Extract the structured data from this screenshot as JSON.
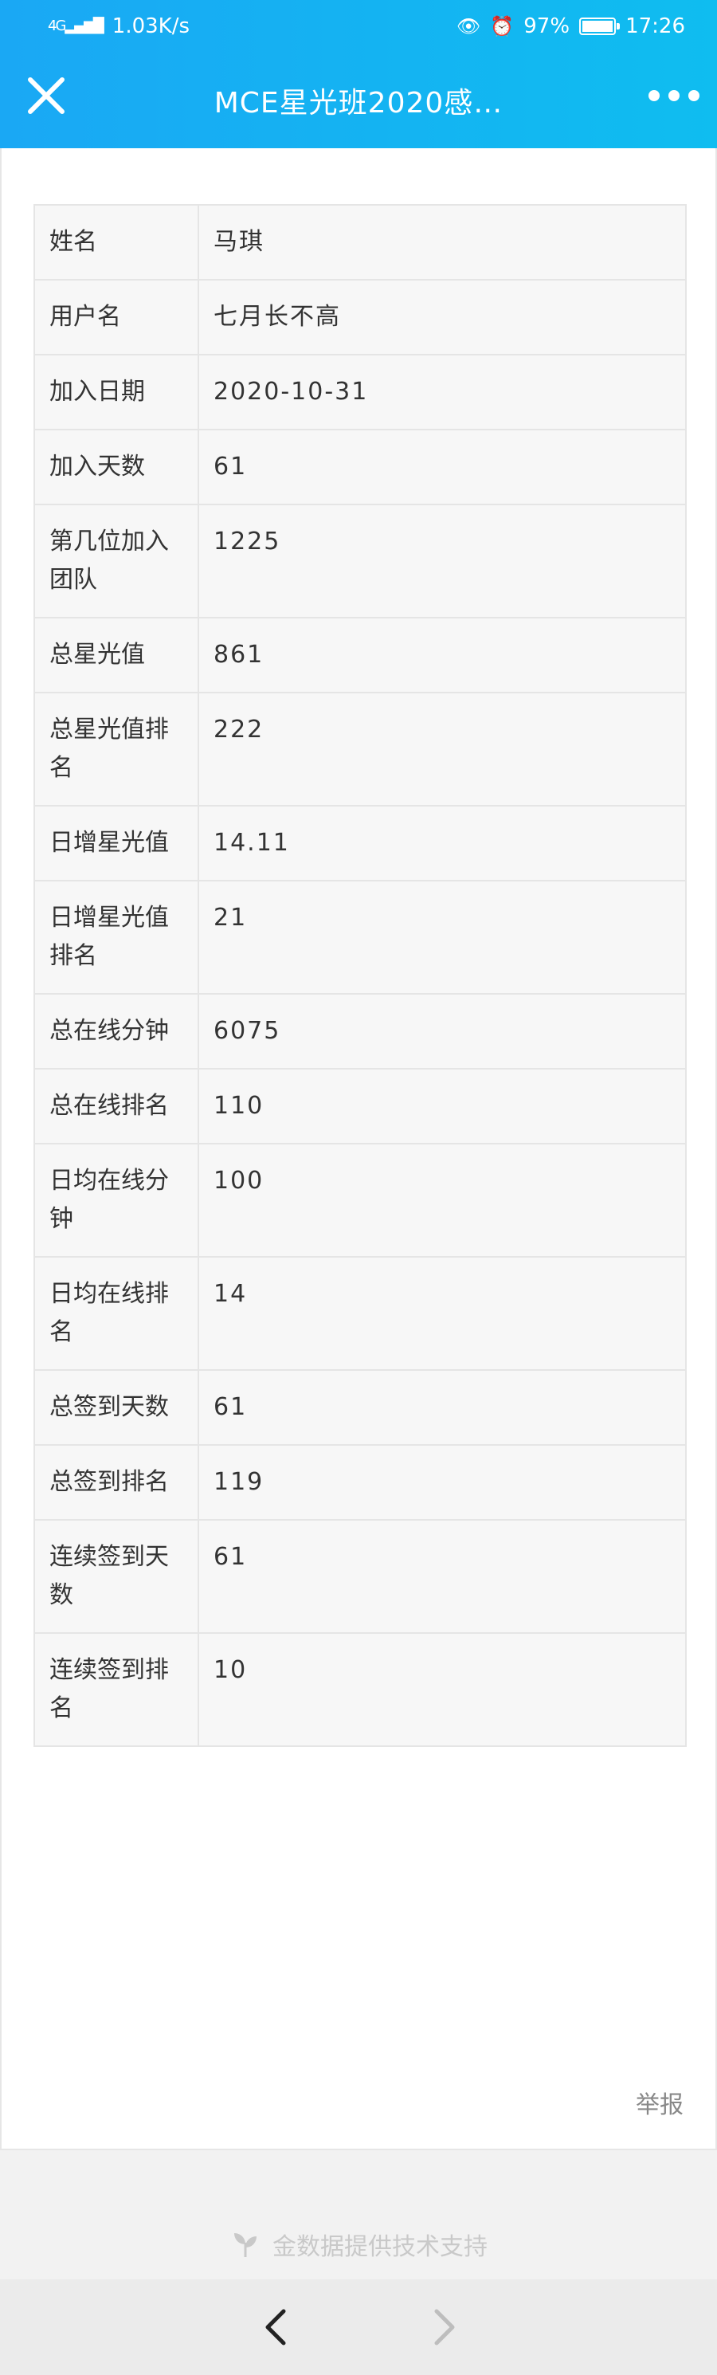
{
  "status_bar": {
    "network_label": "4G",
    "speed": "1.03K/s",
    "battery_percent": "97%",
    "time": "17:26",
    "icons": [
      "signal-icon",
      "eye-icon",
      "alarm-icon",
      "battery-icon"
    ]
  },
  "nav": {
    "title": "MCE星光班2020感…",
    "close_icon": "close-icon",
    "more_icon": "more-icon"
  },
  "rows": [
    {
      "label": "姓名",
      "value": "马琪"
    },
    {
      "label": "用户名",
      "value": "七月长不高"
    },
    {
      "label": "加入日期",
      "value": "2020-10-31"
    },
    {
      "label": "加入天数",
      "value": "61"
    },
    {
      "label": "第几位加入团队",
      "value": "1225"
    },
    {
      "label": "总星光值",
      "value": "861"
    },
    {
      "label": "总星光值排名",
      "value": "222"
    },
    {
      "label": "日增星光值",
      "value": "14.11"
    },
    {
      "label": "日增星光值排名",
      "value": "21"
    },
    {
      "label": "总在线分钟",
      "value": "6075"
    },
    {
      "label": "总在线排名",
      "value": "110"
    },
    {
      "label": "日均在线分钟",
      "value": "100"
    },
    {
      "label": "日均在线排名",
      "value": "14"
    },
    {
      "label": "总签到天数",
      "value": "61"
    },
    {
      "label": "总签到排名",
      "value": "119"
    },
    {
      "label": "连续签到天数",
      "value": "61"
    },
    {
      "label": "连续签到排名",
      "value": "10"
    }
  ],
  "report_label": "举报",
  "footer": {
    "support_text": "金数据提供技术支持",
    "icon": "sprout-icon"
  },
  "bottom_nav": {
    "back_icon": "back-arrow-icon",
    "forward_icon": "forward-arrow-icon"
  },
  "colors": {
    "header": "#1aa8f4",
    "table_bg": "#f7f7f7",
    "border": "#e5e5e5"
  }
}
